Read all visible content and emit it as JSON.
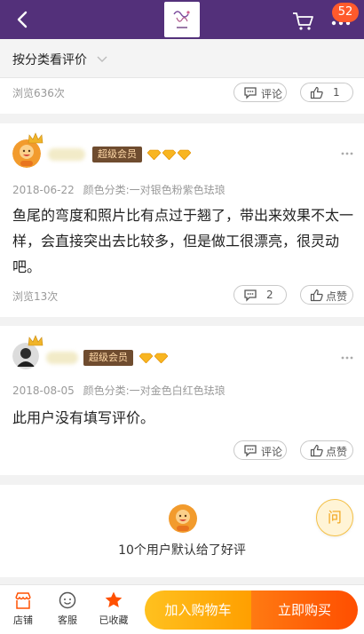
{
  "header": {
    "cart_badge": "52",
    "back_icon": "back-arrow-icon",
    "cart_icon": "cart-icon",
    "more_icon": "more-dots-icon",
    "bar_color": "#53307a"
  },
  "filter": {
    "label": "按分类看评价"
  },
  "top_card": {
    "views": "浏览636次",
    "comment_label": "评论",
    "like_count": "1"
  },
  "reviews": [
    {
      "badge": "超级会员",
      "gems": 3,
      "date": "2018-06-22",
      "variant": "颜色分类:一对银色粉紫色珐琅",
      "text": "鱼尾的弯度和照片比有点过于翘了，带出来效果不太一样，会直接突出去比较多，但是做工很漂亮，很灵动吧。",
      "views": "浏览13次",
      "comment_count": "2",
      "like_label": "点赞"
    },
    {
      "badge": "超级会员",
      "gems": 2,
      "date": "2018-08-05",
      "variant": "颜色分类:一对金色白红色珐琅",
      "text": "此用户没有填写评价。",
      "comment_label": "评论",
      "like_label": "点赞"
    }
  ],
  "default_reviews": {
    "text": "10个用户默认给了好评"
  },
  "float_button": {
    "label": "问"
  },
  "bottom_bar": {
    "shop_label": "店铺",
    "service_label": "客服",
    "fav_label": "已收藏",
    "add_cart_label": "加入购物车",
    "buy_label": "立即购买",
    "accent": "#ff5000"
  }
}
